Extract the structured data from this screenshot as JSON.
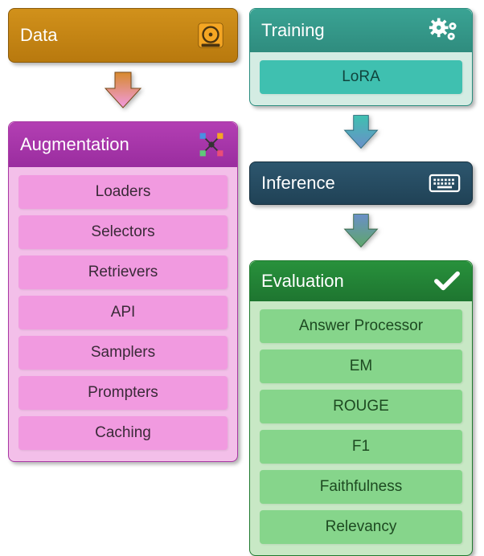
{
  "left": {
    "data": {
      "title": "Data"
    },
    "augmentation": {
      "title": "Augmentation",
      "items": [
        "Loaders",
        "Selectors",
        "Retrievers",
        "API",
        "Samplers",
        "Prompters",
        "Caching"
      ]
    }
  },
  "right": {
    "training": {
      "title": "Training",
      "items": [
        "LoRA"
      ]
    },
    "inference": {
      "title": "Inference"
    },
    "evaluation": {
      "title": "Evaluation",
      "items": [
        "Answer Processor",
        "EM",
        "ROUGE",
        "F1",
        "Faithfulness",
        "Relevancy"
      ]
    }
  },
  "arrows": {
    "left1": {
      "top": "#f19ae0",
      "bottom": "#d78a2e"
    },
    "right1": {
      "top": "#3fc0b0",
      "bottom": "#6a8fc8"
    },
    "right2": {
      "top": "#6a8fc8",
      "bottom": "#5fa66a"
    }
  }
}
